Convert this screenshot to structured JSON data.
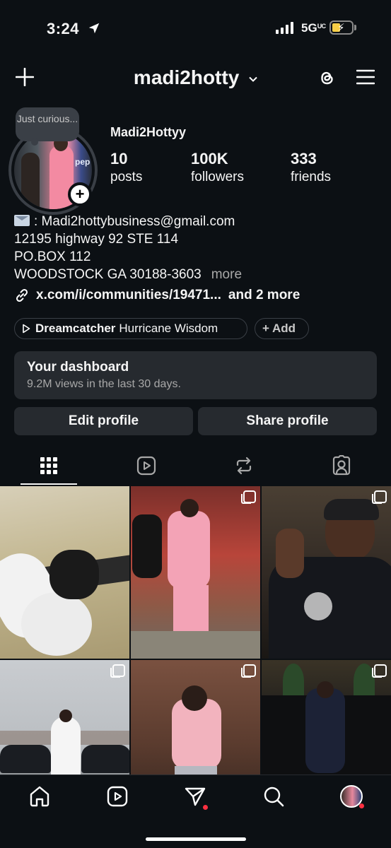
{
  "status_bar": {
    "time": "3:24",
    "network": "5G",
    "network_sup": "UC"
  },
  "header": {
    "username": "madi2hotty"
  },
  "profile": {
    "note": "Just curious...",
    "display_name": "Madi2Hottyy",
    "stats": [
      {
        "value": "10",
        "label": "posts"
      },
      {
        "value": "100K",
        "label": "followers"
      },
      {
        "value": "333",
        "label": "friends"
      }
    ],
    "bio": {
      "email_line": ": Madi2hottybusiness@gmail.com",
      "line2": "12195 highway 92 STE 114",
      "line3": "PO.BOX 112",
      "line4": "WOODSTOCK GA 30188-3603",
      "more": "more"
    },
    "link": {
      "text": "x.com/i/communities/19471...",
      "extra": "and 2 more"
    },
    "music": {
      "song": "Dreamcatcher",
      "artist": "Hurricane Wisdom"
    },
    "add_chip": "+ Add",
    "dashboard": {
      "title": "Your dashboard",
      "subtitle": "9.2M views in the last 30 days."
    },
    "buttons": {
      "edit": "Edit profile",
      "share": "Share profile"
    }
  },
  "tabs": [
    "grid-tab",
    "reels-tab",
    "reposts-tab",
    "tagged-tab"
  ],
  "colors": {
    "background": "#0c1014",
    "button": "#262a2f",
    "accent_red": "#ff3040",
    "battery": "#f7ce46"
  }
}
